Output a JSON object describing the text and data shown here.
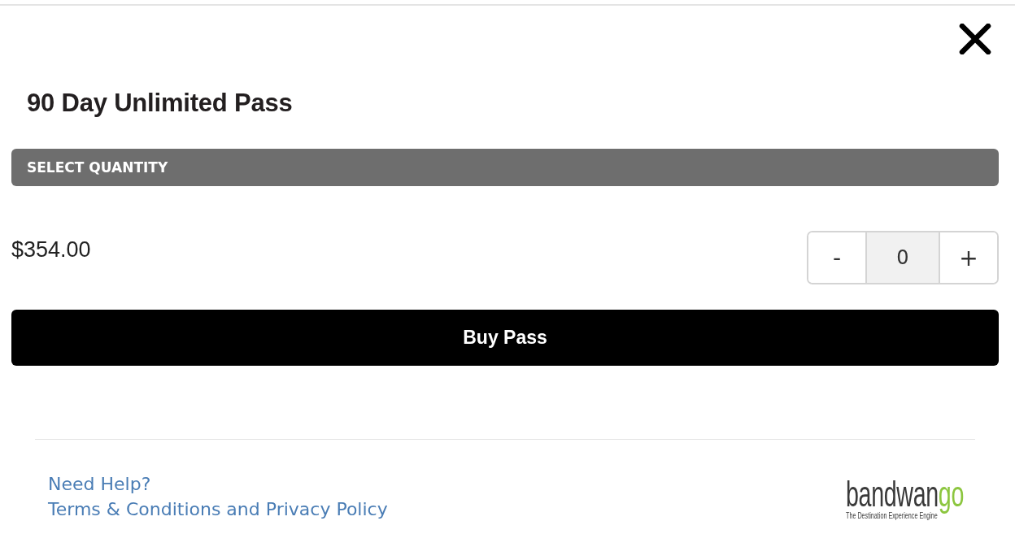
{
  "title": "90 Day Unlimited Pass",
  "section_header": "SELECT QUANTITY",
  "price": "$354.00",
  "quantity": {
    "decrement": "-",
    "value": "0",
    "increment": "+"
  },
  "buy_button": "Buy Pass",
  "footer": {
    "links": [
      "Need Help?",
      "Terms & Conditions and Privacy Policy"
    ],
    "logo": {
      "wordmark_parts": [
        {
          "text": "bandwan",
          "accent": false
        },
        {
          "text": "go",
          "accent": true
        }
      ],
      "tagline": "The Destination Experience Engine"
    }
  }
}
